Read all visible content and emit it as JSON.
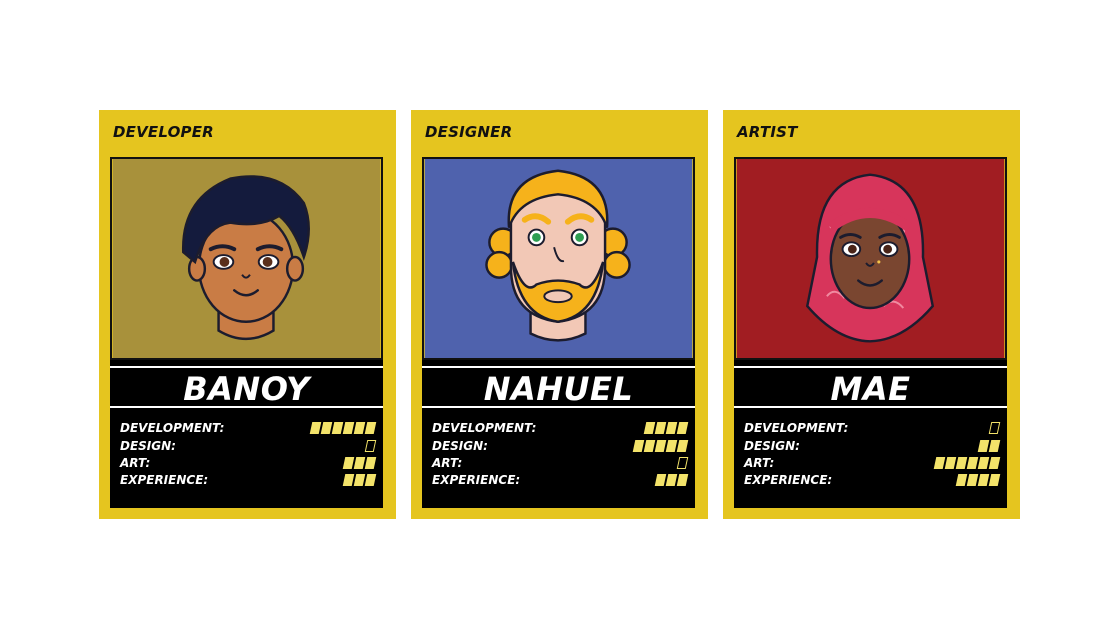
{
  "cards": [
    {
      "role": "DEVELOPER",
      "name": "BANOY",
      "portrait_bg": "#a8913b",
      "stats": [
        {
          "label": "DEVELOPMENT:",
          "value": 6
        },
        {
          "label": "DESIGN:",
          "value": 0
        },
        {
          "label": "ART:",
          "value": 3
        },
        {
          "label": "EXPERIENCE:",
          "value": 3
        }
      ]
    },
    {
      "role": "DESIGNER",
      "name": "NAHUEL",
      "portrait_bg": "#4f62ad",
      "stats": [
        {
          "label": "DEVELOPMENT:",
          "value": 4
        },
        {
          "label": "DESIGN:",
          "value": 5
        },
        {
          "label": "ART:",
          "value": 0
        },
        {
          "label": "EXPERIENCE:",
          "value": 3
        }
      ]
    },
    {
      "role": "ARTIST",
      "name": "MAE",
      "portrait_bg": "#a11d22",
      "stats": [
        {
          "label": "DEVELOPMENT:",
          "value": 0
        },
        {
          "label": "DESIGN:",
          "value": 2
        },
        {
          "label": "ART:",
          "value": 6
        },
        {
          "label": "EXPERIENCE:",
          "value": 4
        }
      ]
    }
  ],
  "colors": {
    "card": "#e5c51f",
    "pip": "#f3e36a"
  }
}
